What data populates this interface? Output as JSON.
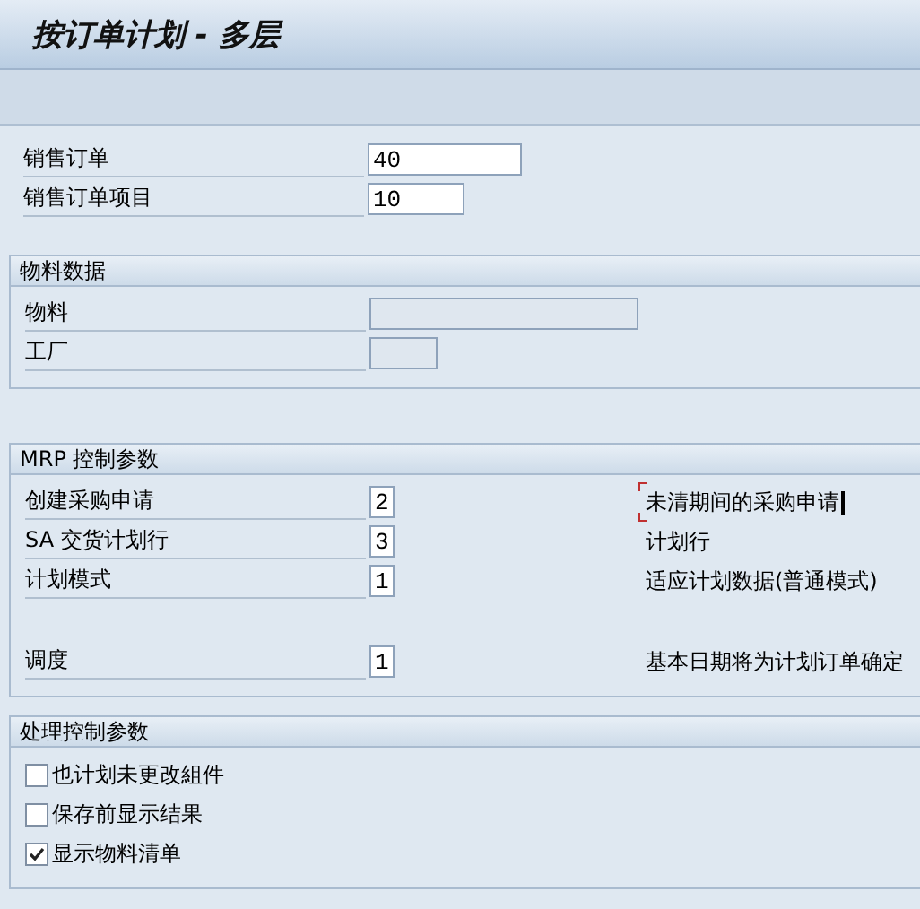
{
  "window": {
    "title": "按订单计划 - 多层"
  },
  "header_fields": [
    {
      "label": "销售订单",
      "value": "40"
    },
    {
      "label": "销售订单项目",
      "value": "10"
    }
  ],
  "material_data": {
    "title": "物料数据",
    "fields": [
      {
        "label": "物料",
        "disabled": true
      },
      {
        "label": "工厂",
        "disabled": true
      }
    ]
  },
  "mrp_control": {
    "title": "MRP 控制参数",
    "rows": [
      {
        "label": "创建采购申请",
        "value": "2",
        "description": "未清期间的采购申请",
        "focused": true
      },
      {
        "label": "SA 交货计划行",
        "value": "3",
        "description": "计划行"
      },
      {
        "label": "计划模式",
        "value": "1",
        "description": "适应计划数据(普通模式)"
      },
      {
        "label": "调度",
        "value": "1",
        "description": "基本日期将为计划订单确定"
      }
    ]
  },
  "processing_control": {
    "title": "处理控制参数",
    "options": [
      {
        "label": "也计划未更改組件",
        "checked": false
      },
      {
        "label": "保存前显示结果",
        "checked": false
      },
      {
        "label": "显示物料清单",
        "checked": true
      }
    ]
  }
}
